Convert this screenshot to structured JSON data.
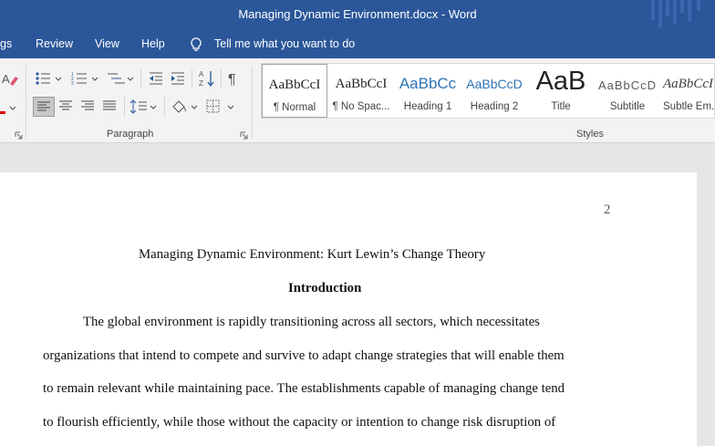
{
  "window": {
    "title": "Managing Dynamic Environment.docx  -  Word"
  },
  "tabs": {
    "partial": "gs",
    "review": "Review",
    "view": "View",
    "help": "Help",
    "tell_me": "Tell me what you want to do"
  },
  "ribbon": {
    "paragraph_label": "Paragraph",
    "styles_label": "Styles",
    "styles": [
      {
        "preview": "AaBbCcI",
        "label": "¶ Normal"
      },
      {
        "preview": "AaBbCcI",
        "label": "¶ No Spac..."
      },
      {
        "preview": "AaBbCc",
        "label": "Heading 1"
      },
      {
        "preview": "AaBbCcD",
        "label": "Heading 2"
      },
      {
        "preview": "AaB",
        "label": "Title"
      },
      {
        "preview": "AaBbCcD",
        "label": "Subtitle"
      },
      {
        "preview": "AaBbCcI",
        "label": "Subtle Em..."
      }
    ]
  },
  "colors": {
    "brand": "#2b579a",
    "heading_blue": "#2e74b5"
  },
  "document": {
    "page_number": "2",
    "title": "Managing Dynamic Environment: Kurt Lewin’s Change Theory",
    "heading": "Introduction",
    "lines": [
      "The global environment is rapidly transitioning across all sectors, which necessitates",
      "organizations that intend to compete and survive to adapt change strategies that will enable them",
      "to remain relevant while maintaining pace. The establishments capable of managing change tend",
      "to flourish efficiently, while those without the capacity or intention to change risk disruption of"
    ]
  }
}
